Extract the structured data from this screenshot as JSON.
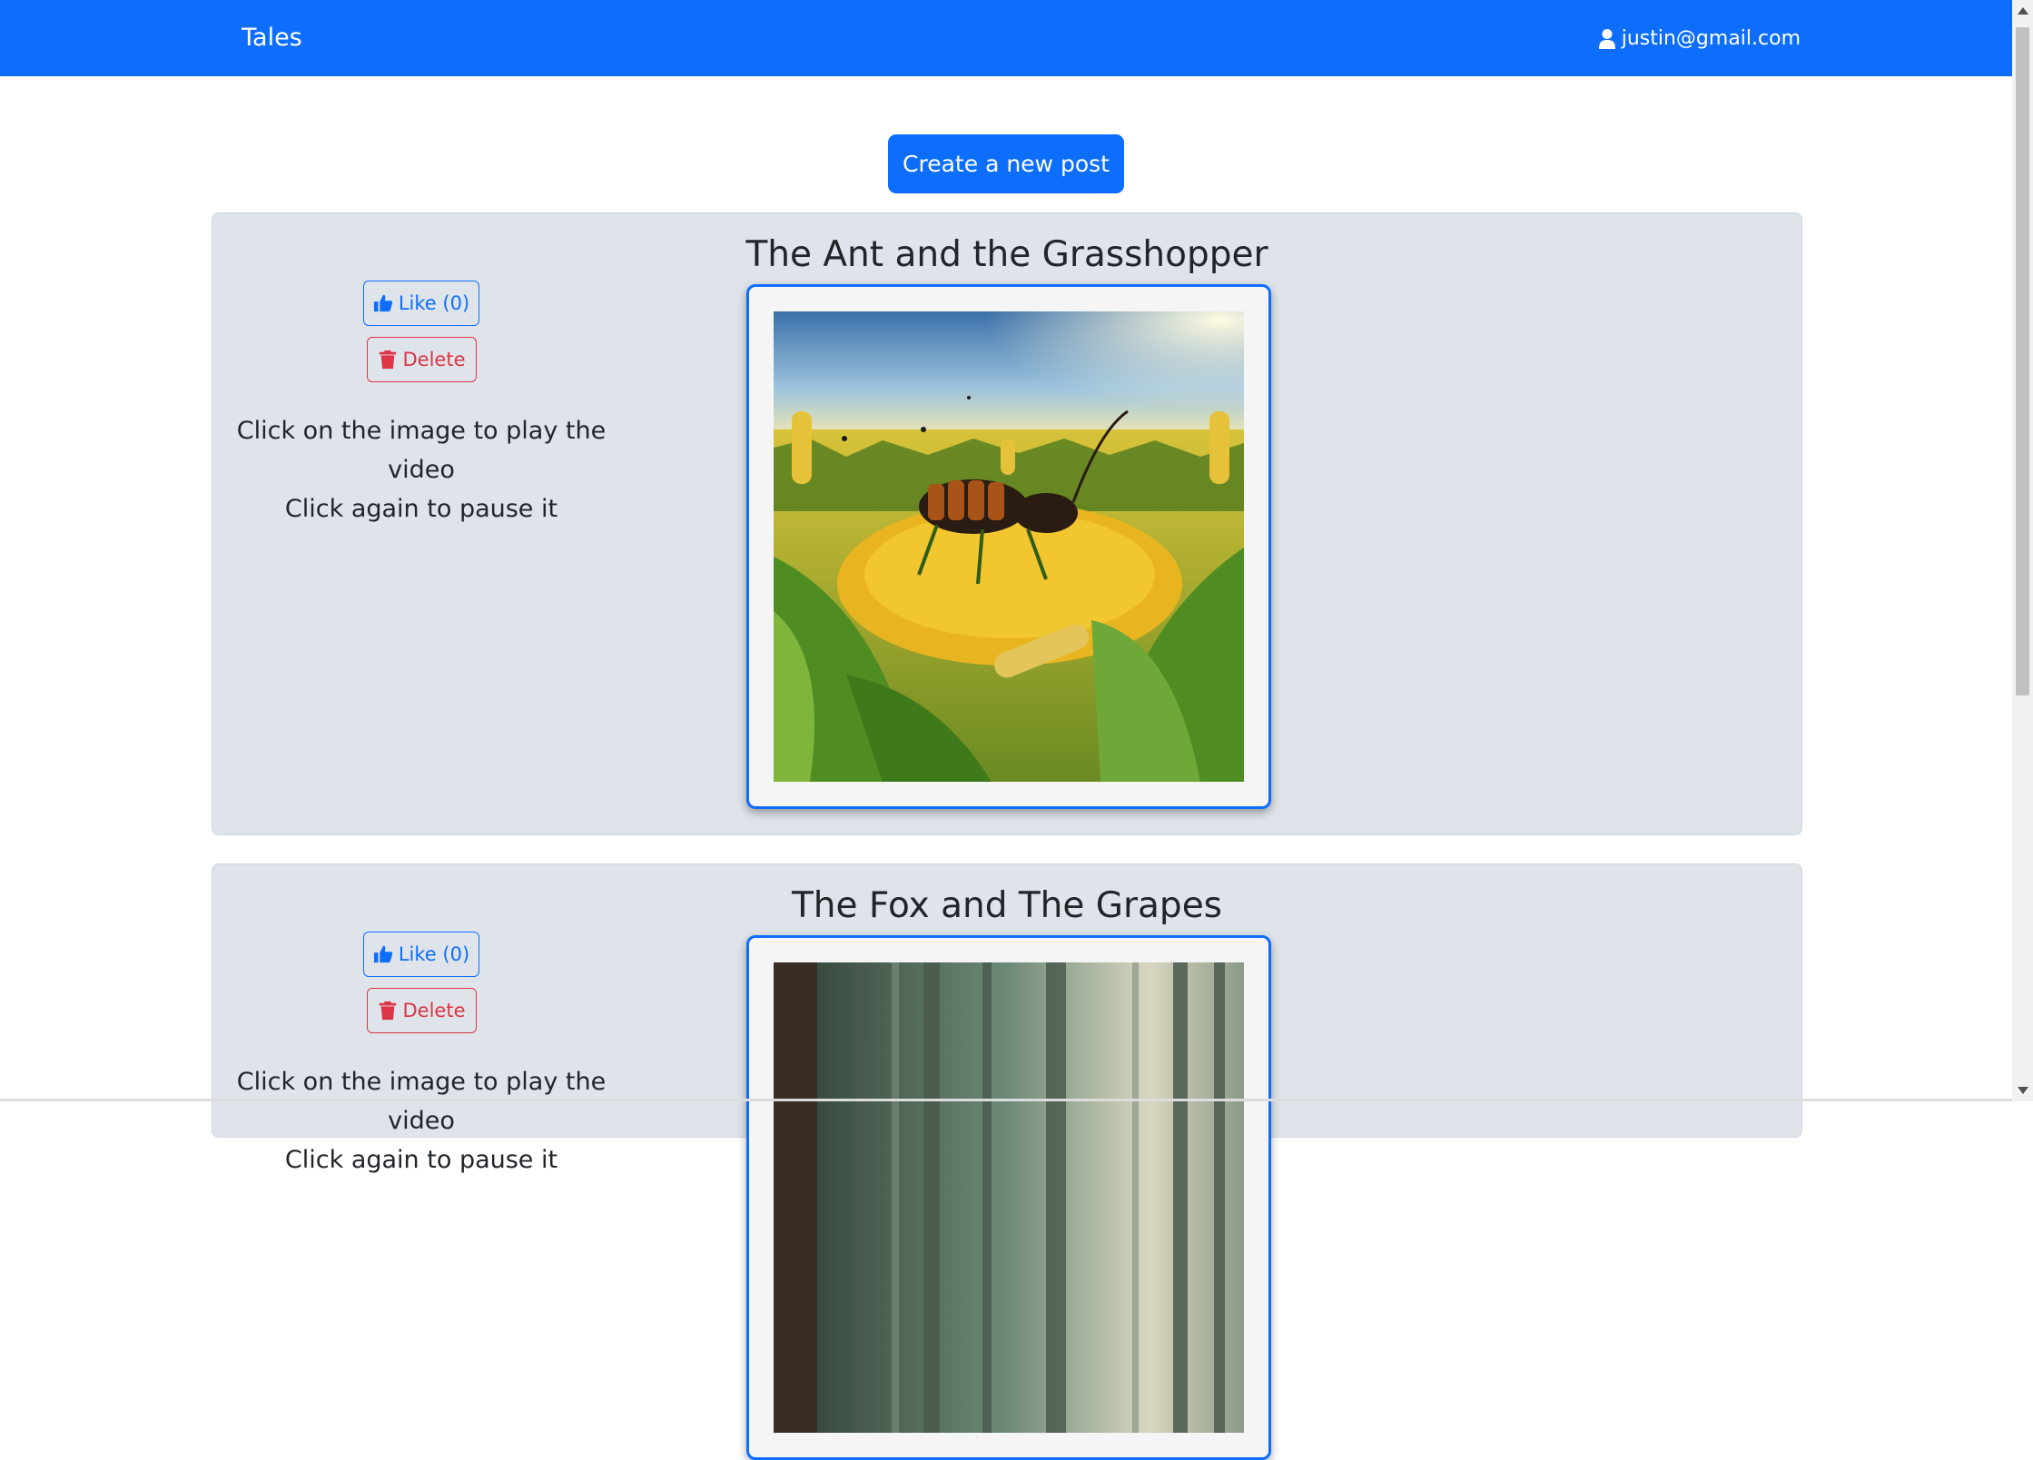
{
  "navbar": {
    "brand": "Tales",
    "user_email": "justin@gmail.com"
  },
  "create_button": "Create a new post",
  "posts": [
    {
      "title": "The Ant and the Grasshopper",
      "like_label": "Like (0)",
      "delete_label": "Delete",
      "hint_line1": "Click on the image to play the video",
      "hint_line2": "Click again to pause it",
      "image_subject": "grasshopper-in-cornfield"
    },
    {
      "title": "The Fox and The Grapes",
      "like_label": "Like (0)",
      "delete_label": "Delete",
      "hint_line1": "Click on the image to play the video",
      "hint_line2": "Click again to pause it",
      "image_subject": "forest-trees"
    }
  ],
  "colors": {
    "primary": "#0d6efd",
    "danger": "#dc3545",
    "card_bg": "#dfe4ea"
  },
  "icons": {
    "user": "user-icon",
    "like": "thumbs-up-icon",
    "delete": "trash-icon"
  }
}
